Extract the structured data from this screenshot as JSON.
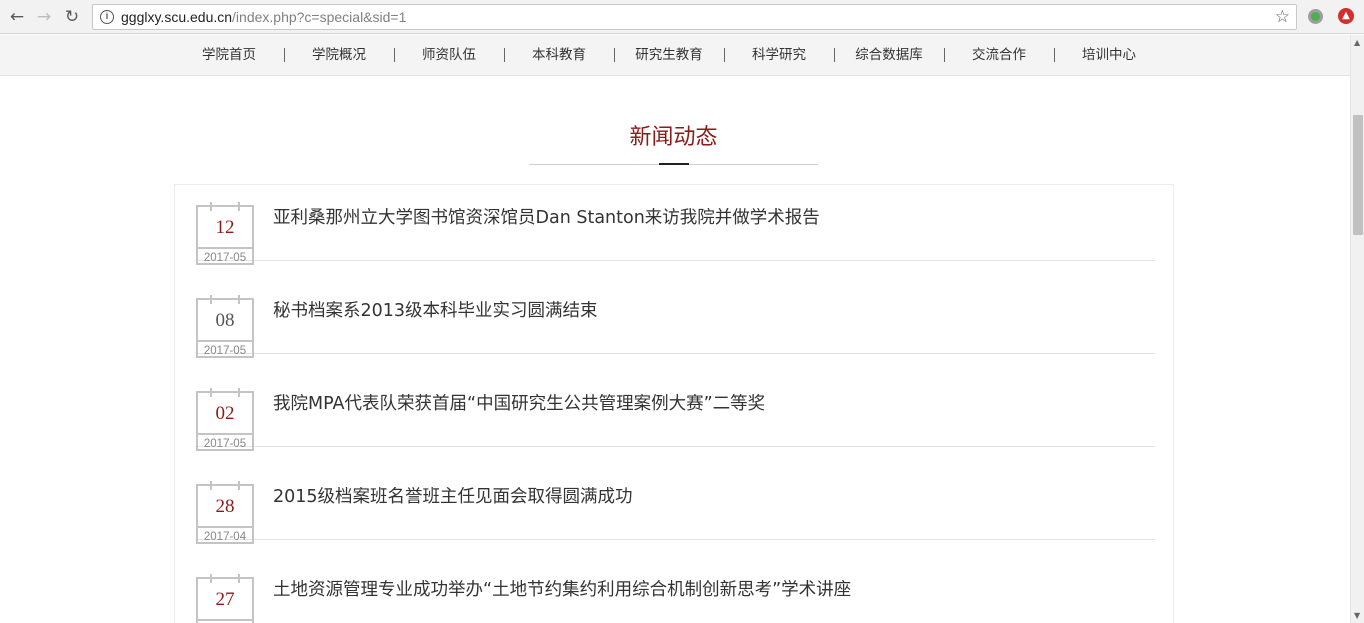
{
  "browser": {
    "url_host": "ggglxy.scu.edu.cn",
    "url_path": "/index.php?c=special&sid=1"
  },
  "nav": {
    "items": [
      "学院首页",
      "学院概况",
      "师资队伍",
      "本科教育",
      "研究生教育",
      "科学研究",
      "综合数据库",
      "交流合作",
      "培训中心"
    ]
  },
  "section": {
    "title": "新闻动态"
  },
  "news": [
    {
      "day": "12",
      "ym": "2017-05",
      "title": "亚利桑那州立大学图书馆资深馆员Dan Stanton来访我院并做学术报告"
    },
    {
      "day": "08",
      "ym": "2017-05",
      "title": "秘书档案系2013级本科毕业实习圆满结束"
    },
    {
      "day": "02",
      "ym": "2017-05",
      "title": "我院MPA代表队荣获首届“中国研究生公共管理案例大赛”二等奖"
    },
    {
      "day": "28",
      "ym": "2017-04",
      "title": "2015级档案班名誉班主任见面会取得圆满成功"
    },
    {
      "day": "27",
      "ym": "",
      "title": "土地资源管理专业成功举办“土地节约集约利用综合机制创新思考”学术讲座"
    }
  ],
  "icons": {
    "back": "back-arrow-icon",
    "forward": "forward-arrow-icon",
    "reload": "reload-icon",
    "info": "info-icon",
    "star": "bookmark-star-icon"
  },
  "colors": {
    "accent": "#8b1a1a"
  }
}
